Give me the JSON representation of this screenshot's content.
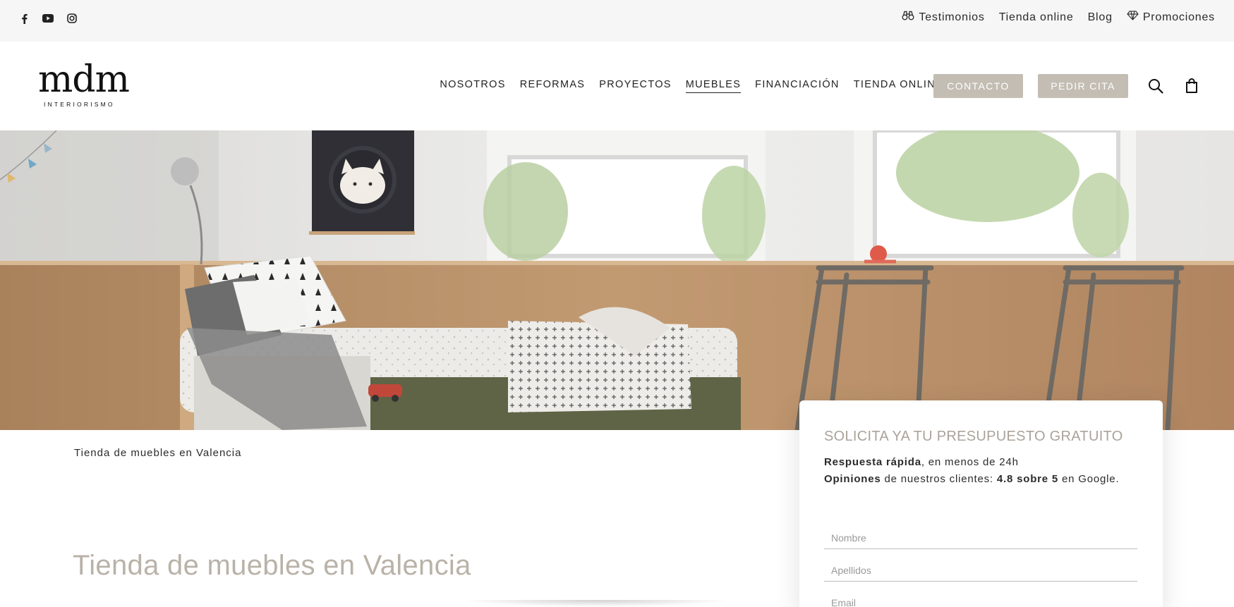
{
  "topbar": {
    "social": [
      {
        "icon": "facebook-icon",
        "label": "f"
      },
      {
        "icon": "youtube-icon",
        "label": "▶"
      },
      {
        "icon": "instagram-icon",
        "label": "◎"
      }
    ],
    "links": [
      {
        "icon": "binoculars-icon",
        "label": "Testimonios"
      },
      {
        "icon": "",
        "label": "Tienda online"
      },
      {
        "icon": "",
        "label": "Blog"
      },
      {
        "icon": "diamond-icon",
        "label": "Promociones"
      }
    ]
  },
  "header": {
    "logo_main": "mdm",
    "logo_sub": "INTERIORISMO",
    "nav": [
      {
        "label": "NOSOTROS",
        "active": false
      },
      {
        "label": "REFORMAS",
        "active": false
      },
      {
        "label": "PROYECTOS",
        "active": false
      },
      {
        "label": "MUEBLES",
        "active": true
      },
      {
        "label": "FINANCIACIÓN",
        "active": false
      },
      {
        "label": "TIENDA ONLINE",
        "active": false
      }
    ],
    "contact_button": "CONTACTO",
    "appointment_button": "PEDIR CITA",
    "search_icon": "search-icon",
    "cart_icon": "shopping-bag-icon"
  },
  "content": {
    "breadcrumb": "Tienda de muebles en Valencia",
    "page_title": "Tienda de muebles en Valencia"
  },
  "quote_form": {
    "title": "SOLICITA YA TU PRESUPUESTO GRATUITO",
    "line1_bold": "Respuesta rápida",
    "line1_rest": ", en menos de 24h",
    "line2_bold": "Opiniones",
    "line2_mid": " de nuestros clientes: ",
    "line2_rating": "4.8 sobre 5",
    "line2_rest": " en Google.",
    "fields": [
      {
        "placeholder": "Nombre",
        "value": ""
      },
      {
        "placeholder": "Apellidos",
        "value": ""
      },
      {
        "placeholder": "Email",
        "value": ""
      }
    ]
  },
  "colors": {
    "accent_button": "#c3bdb4",
    "title_muted": "#b9b2a8",
    "topbar_bg": "#f6f6f6"
  }
}
